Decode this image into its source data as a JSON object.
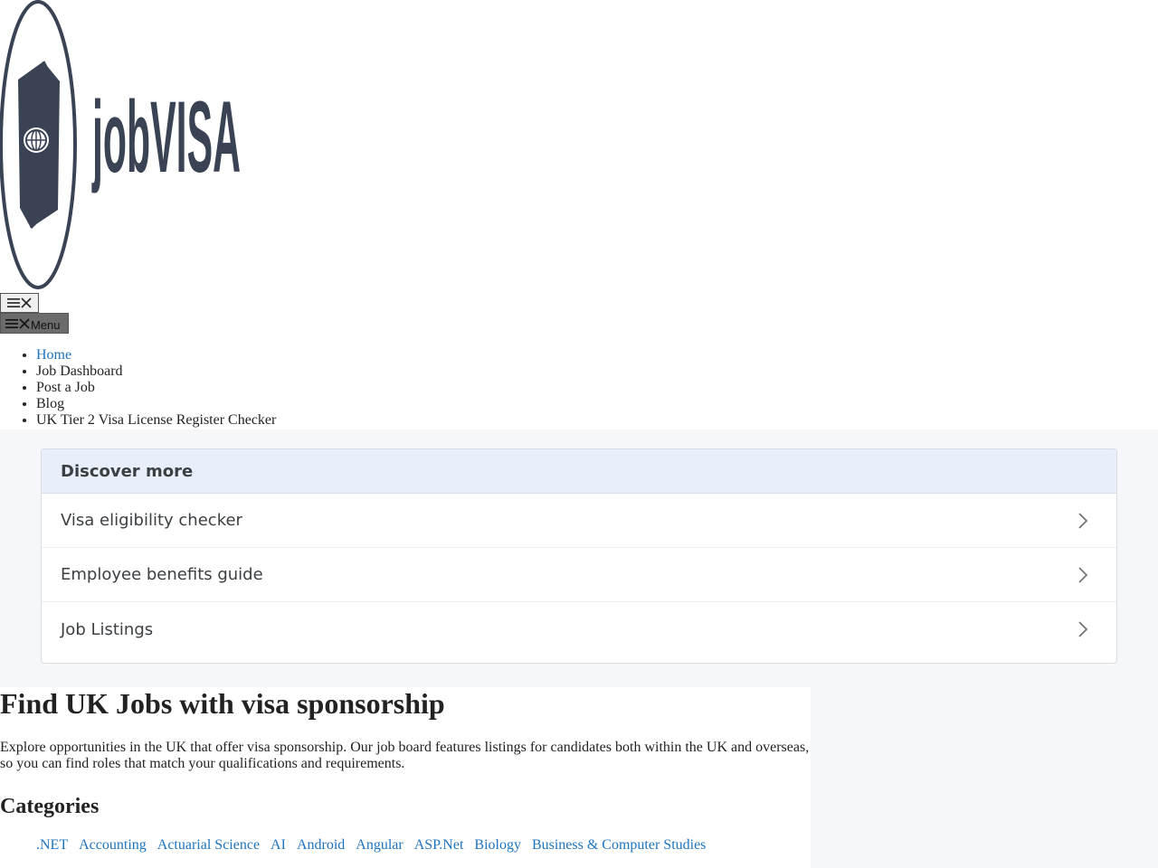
{
  "site": {
    "logo_text": "jobVISA",
    "brand_color": "#3a4354"
  },
  "header": {
    "toggle_icon_names": [
      "hamburger-icon",
      "close-icon"
    ],
    "menu_button_label": "Menu"
  },
  "nav": {
    "items": [
      {
        "label": "Home",
        "link": true
      },
      {
        "label": "Job Dashboard",
        "link": false
      },
      {
        "label": "Post a Job",
        "link": false
      },
      {
        "label": "Blog",
        "link": false
      },
      {
        "label": "UK Tier 2 Visa License Register Checker",
        "link": false
      }
    ]
  },
  "discover": {
    "title": "Discover more",
    "items": [
      {
        "label": "Visa eligibility checker"
      },
      {
        "label": "Employee benefits guide"
      },
      {
        "label": "Job Listings"
      }
    ]
  },
  "main": {
    "title": "Find UK Jobs with visa sponsorship",
    "intro": "Explore opportunities in the UK that offer visa sponsorship. Our job board features listings for candidates both within the UK and overseas, so you can find roles that match your qualifications and requirements.",
    "categories_heading": "Categories",
    "categories": [
      ".NET",
      "Accounting",
      "Actuarial Science",
      "AI",
      "Android",
      "Angular",
      "ASP.Net",
      "Biology",
      "Business & Computer Studies"
    ]
  },
  "colors": {
    "link": "#1e73be",
    "discover_header_bg": "#e8effb",
    "page_band": "#f6f7f9"
  }
}
